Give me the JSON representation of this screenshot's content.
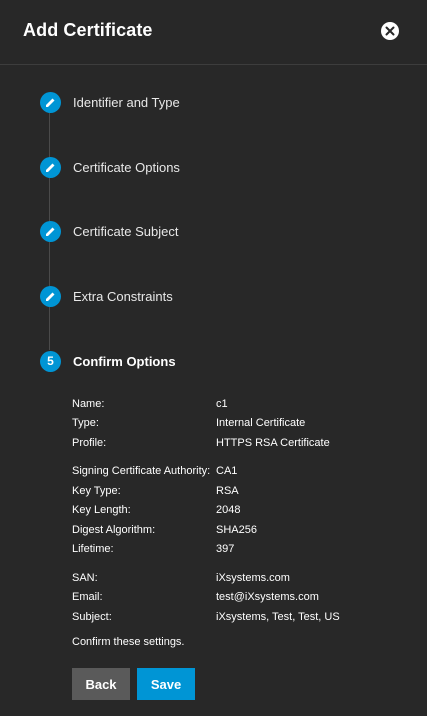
{
  "dialog": {
    "title": "Add Certificate",
    "close_icon": "close-icon"
  },
  "steps": [
    {
      "label": "Identifier and Type",
      "icon": "pencil-icon",
      "state": "done"
    },
    {
      "label": "Certificate Options",
      "icon": "pencil-icon",
      "state": "done"
    },
    {
      "label": "Certificate Subject",
      "icon": "pencil-icon",
      "state": "done"
    },
    {
      "label": "Extra Constraints",
      "icon": "pencil-icon",
      "state": "done"
    },
    {
      "label": "Confirm Options",
      "number": "5",
      "state": "active"
    }
  ],
  "summary": {
    "group1": [
      {
        "key": "Name:",
        "value": "c1"
      },
      {
        "key": "Type:",
        "value": "Internal Certificate"
      },
      {
        "key": "Profile:",
        "value": "HTTPS RSA Certificate"
      }
    ],
    "group2": [
      {
        "key": "Signing Certificate Authority:",
        "value": "CA1"
      },
      {
        "key": "Key Type:",
        "value": "RSA"
      },
      {
        "key": "Key Length:",
        "value": "2048"
      },
      {
        "key": "Digest Algorithm:",
        "value": "SHA256"
      },
      {
        "key": "Lifetime:",
        "value": "397"
      }
    ],
    "group3": [
      {
        "key": "SAN:",
        "value": "iXsystems.com"
      },
      {
        "key": "Email:",
        "value": "test@iXsystems.com"
      },
      {
        "key": "Subject:",
        "value": "iXsystems, Test, Test, US"
      }
    ]
  },
  "confirm_text": "Confirm these settings.",
  "buttons": {
    "back": "Back",
    "save": "Save"
  },
  "colors": {
    "accent": "#0095d5",
    "background": "#282828",
    "back_button": "#5a5a5a"
  }
}
